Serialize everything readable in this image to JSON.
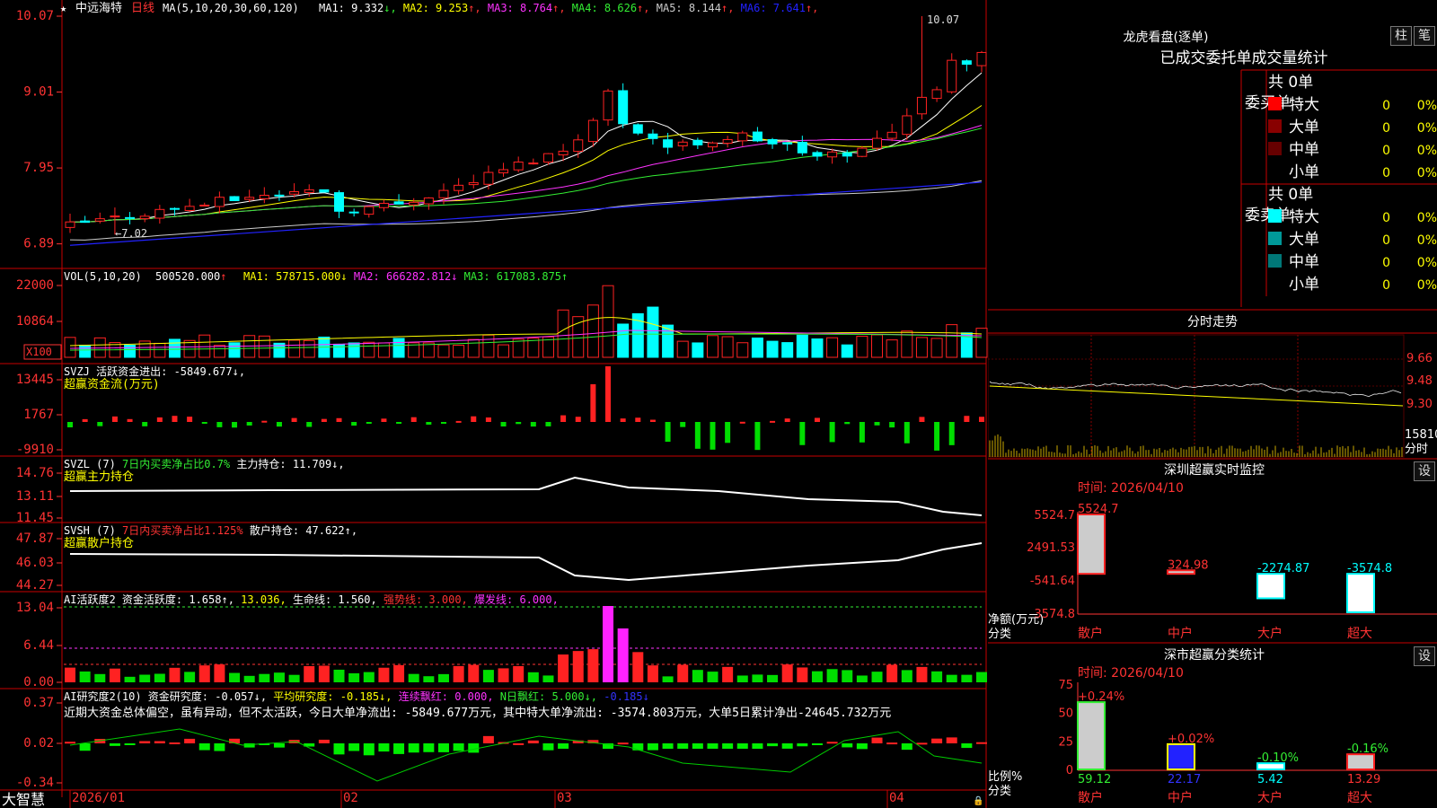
{
  "stock": {
    "name": "中远海特",
    "period": "日线"
  },
  "main": {
    "ma_header": "MA(5,10,20,30,60,120)",
    "ma": [
      {
        "label": "MA1: ",
        "value": "9.332",
        "arrow": "↓",
        "color": "#ffffff"
      },
      {
        "label": "MA2: ",
        "value": "9.253",
        "arrow": "↑",
        "color": "#ffff00"
      },
      {
        "label": "MA3: ",
        "value": "8.764",
        "arrow": "↑",
        "color": "#ff33ff"
      },
      {
        "label": "MA4: ",
        "value": "8.626",
        "arrow": "↑",
        "color": "#33ee33"
      },
      {
        "label": "MA5: ",
        "value": "8.144",
        "arrow": "↑",
        "color": "#cccccc"
      },
      {
        "label": "MA6: ",
        "value": "7.641",
        "arrow": "↑",
        "color": "#2222ff"
      }
    ],
    "y_ticks": [
      "10.07",
      "9.01",
      "7.95",
      "6.89"
    ],
    "high_label": "10.07",
    "low_label": "7.02"
  },
  "vol": {
    "header": "VOL(5,10,20)",
    "value": "500520.000",
    "ma": [
      {
        "t": "MA1: 578715.000↓",
        "c": "#ffff00"
      },
      {
        "t": "MA2: 666282.812↓",
        "c": "#ff33ff"
      },
      {
        "t": "MA3: 617083.875↑",
        "c": "#33ee33"
      }
    ],
    "y_ticks": [
      "22000",
      "10864"
    ],
    "unit": "X100"
  },
  "svzj": {
    "header": "SVZJ  活跃资金进出: -5849.677↓,",
    "sub": "超赢资金流(万元)",
    "y_ticks": [
      "13445",
      "1767",
      "-9910"
    ]
  },
  "svzl": {
    "header_a": "SVZL (7)",
    "header_b": "7日内买卖净占比0.7%",
    "header_c": "主力持仓: 11.709↓,",
    "sub": "超赢主力持仓",
    "y_ticks": [
      "14.76",
      "13.11",
      "11.45"
    ]
  },
  "svsh": {
    "header_a": "SVSH (7)",
    "header_b": "7日内买卖净占比1.125%",
    "header_c": "散户持仓: 47.622↑,",
    "sub": "超赢散户持仓",
    "y_ticks": [
      "47.87",
      "46.03",
      "44.27"
    ]
  },
  "ai1": {
    "header": [
      {
        "t": "AI活跃度2 资金活跃度: 1.658↑,",
        "c": "#ffffff"
      },
      {
        "t": "13.036,",
        "c": "#ffff00"
      },
      {
        "t": "生命线: 1.560,",
        "c": "#ffffff"
      },
      {
        "t": "强势线: 3.000,",
        "c": "#ff3333"
      },
      {
        "t": "爆发线: 6.000,",
        "c": "#ff33ff"
      }
    ],
    "y_ticks": [
      "13.04",
      "6.44",
      "0.00"
    ]
  },
  "ai2": {
    "header": [
      {
        "t": "AI研究度2(10) 资金研究度: -0.057↓,",
        "c": "#ffffff"
      },
      {
        "t": "平均研究度: -0.185↓,",
        "c": "#ffff00"
      },
      {
        "t": "连续飘红: 0.000,",
        "c": "#ff33ff"
      },
      {
        "t": "N日飘红: 5.000↓,",
        "c": "#33ee33"
      },
      {
        "t": "-0.185↓",
        "c": "#3333ff"
      }
    ],
    "text": "近期大资金总体偏空，虽有异动，但不太活跃，今日大单净流出: -5849.677万元，其中特大单净流出: -3574.803万元，大单5日累计净出-24645.732万元",
    "y_ticks": [
      "0.37",
      "0.02",
      "-0.34"
    ]
  },
  "xaxis": {
    "logo": "大智慧",
    "labels": [
      "2026/01",
      "02",
      "03",
      "04"
    ]
  },
  "lhb": {
    "title": "龙虎看盘(逐单)",
    "btn1": "柱",
    "btn2": "笔",
    "header": "已成交委托单成交量统计",
    "buy_label": "委买单",
    "sell_label": "委卖单",
    "buy_total": "共 0单",
    "sell_total": "共 0单",
    "buy_rows": [
      {
        "name": "特大",
        "n": "0",
        "p": "0%",
        "c": "#ff0000"
      },
      {
        "name": "大单",
        "n": "0",
        "p": "0%",
        "c": "#880000"
      },
      {
        "name": "中单",
        "n": "0",
        "p": "0%",
        "c": "#660000"
      },
      {
        "name": "小单",
        "n": "0",
        "p": "0%",
        "c": ""
      }
    ],
    "sell_rows": [
      {
        "name": "特大",
        "n": "0",
        "p": "0%",
        "c": "#00ffff"
      },
      {
        "name": "大单",
        "n": "0",
        "p": "0%",
        "c": "#009999"
      },
      {
        "name": "中单",
        "n": "0",
        "p": "0%",
        "c": "#007777"
      },
      {
        "name": "小单",
        "n": "0",
        "p": "0%",
        "c": ""
      }
    ]
  },
  "intraday": {
    "title": "分时走势",
    "y_ticks": [
      "9.66",
      "9.48",
      "9.30"
    ],
    "vol_label": "15810",
    "time_label": "分时"
  },
  "sz_monitor": {
    "title": "深圳超赢实时监控",
    "btn": "设",
    "time": "时间: 2026/04/10",
    "y_ticks": [
      "5524.7",
      "2491.53",
      "-541.64",
      "-3574.8"
    ],
    "ylabel": "净额(万元)",
    "xlabel": "分类"
  },
  "sz_class": {
    "title": "深市超赢分类统计",
    "btn": "设",
    "time": "时间: 2026/04/10",
    "y_ticks": [
      "75",
      "50",
      "25",
      "0"
    ],
    "ylabel": "比例%",
    "xlabel": "分类"
  },
  "chart_data": [
    {
      "type": "candlestick",
      "title": "中远海特 日线",
      "series": [
        {
          "name": "MA1"
        },
        {
          "name": "MA2"
        },
        {
          "name": "MA3"
        },
        {
          "name": "MA4"
        },
        {
          "name": "MA5"
        },
        {
          "name": "MA6"
        }
      ],
      "ylim": [
        6.76,
        10.12
      ],
      "high": 10.07,
      "low": 7.02,
      "x_labels": [
        "2026/01",
        "02",
        "03",
        "04"
      ]
    },
    {
      "type": "bar",
      "title": "VOL(5,10,20)",
      "ylim": [
        0,
        22000
      ]
    },
    {
      "type": "bar",
      "title": "超赢资金流(万元)",
      "ylim": [
        -9910,
        13445
      ]
    },
    {
      "type": "bar",
      "title": "深圳超赢实时监控",
      "categories": [
        "散户",
        "中户",
        "大户",
        "超大"
      ],
      "values": [
        5524.7,
        324.98,
        -2274.87,
        -3574.8
      ],
      "ylim": [
        -3574.8,
        5524.7
      ],
      "ylabel": "净额(万元)",
      "xlabel": "分类"
    },
    {
      "type": "bar",
      "title": "深市超赢分类统计",
      "categories": [
        "散户",
        "中户",
        "大户",
        "超大"
      ],
      "values": [
        59.12,
        22.17,
        5.42,
        13.29
      ],
      "changes": [
        "+0.24%",
        "+0.02%",
        "-0.10%",
        "-0.16%"
      ],
      "ylim": [
        0,
        75
      ],
      "ylabel": "比例%",
      "xlabel": "分类"
    }
  ]
}
